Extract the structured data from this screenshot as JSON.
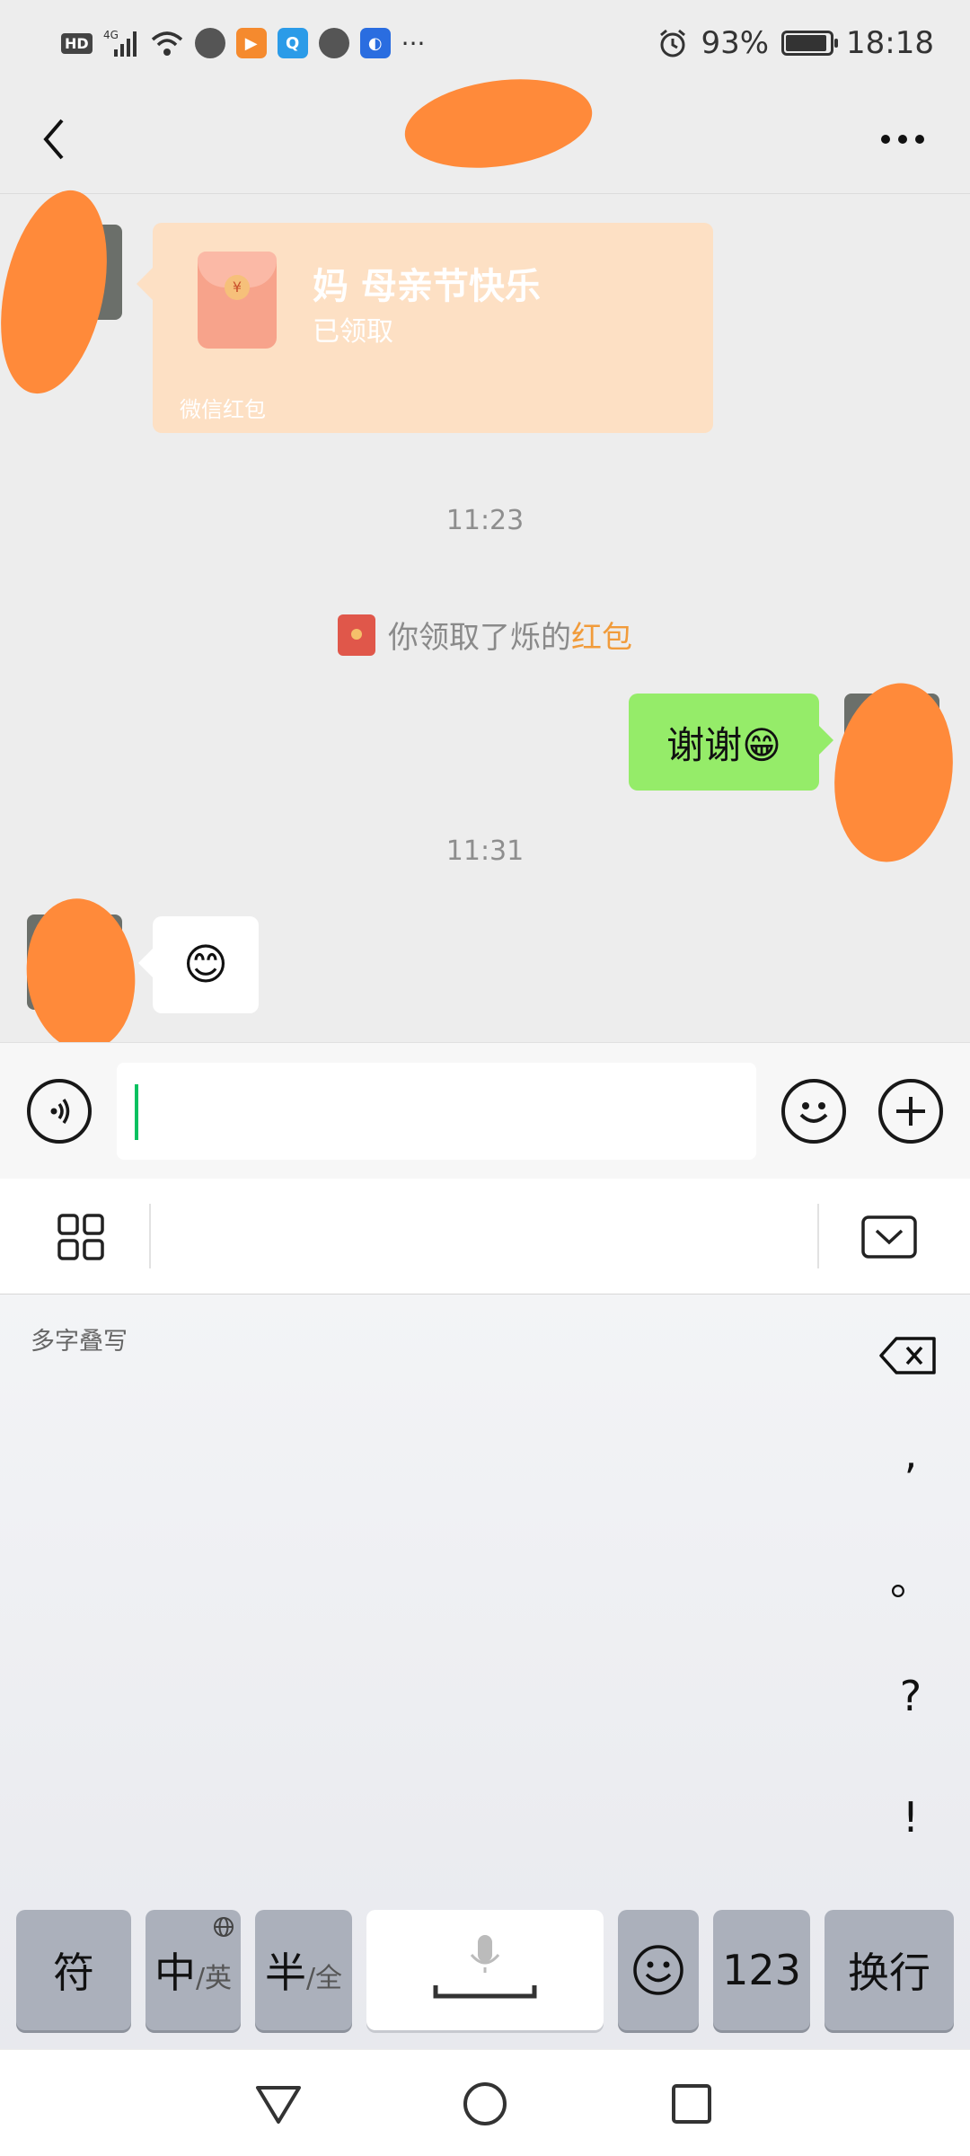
{
  "status_bar": {
    "left_icons": [
      "hd-icon",
      "4g-signal-icon",
      "wifi-icon",
      "app-icon",
      "video-app-icon",
      "search-app-icon",
      "chat-app-icon",
      "bulb-app-icon"
    ],
    "more": "···",
    "battery": "93%",
    "battery_level": 0.93,
    "time": "18:18"
  },
  "header": {
    "title": "",
    "back_icon": "chevron-left-icon",
    "more_icon": "more-dots-icon"
  },
  "messages": {
    "red_packet": {
      "title": "妈 母亲节快乐",
      "status": "已领取",
      "footer": "微信红包"
    },
    "time1": "11:23",
    "system": {
      "prefix": "你领取了烁的",
      "link": "红包"
    },
    "my_message": "谢谢😁",
    "time2": "11:31",
    "other_emoji": "😊"
  },
  "input_bar": {
    "value": "",
    "voice_icon": "voice-icon",
    "emoji_icon": "emoji-icon",
    "plus_icon": "plus-icon"
  },
  "keyboard": {
    "hint": "多字叠写",
    "punctuation": [
      ",",
      "。",
      "?",
      "!"
    ],
    "keys": {
      "symbol": "符",
      "zh": "中",
      "zh_sub": "/英",
      "half": "半",
      "half_sub": "/全",
      "num": "123",
      "newline": "换行"
    }
  },
  "colors": {
    "accent_green": "#95ec69",
    "wechat_green": "#07c160",
    "red_packet_bg": "#fde0c4",
    "link_orange": "#f19b3a"
  }
}
